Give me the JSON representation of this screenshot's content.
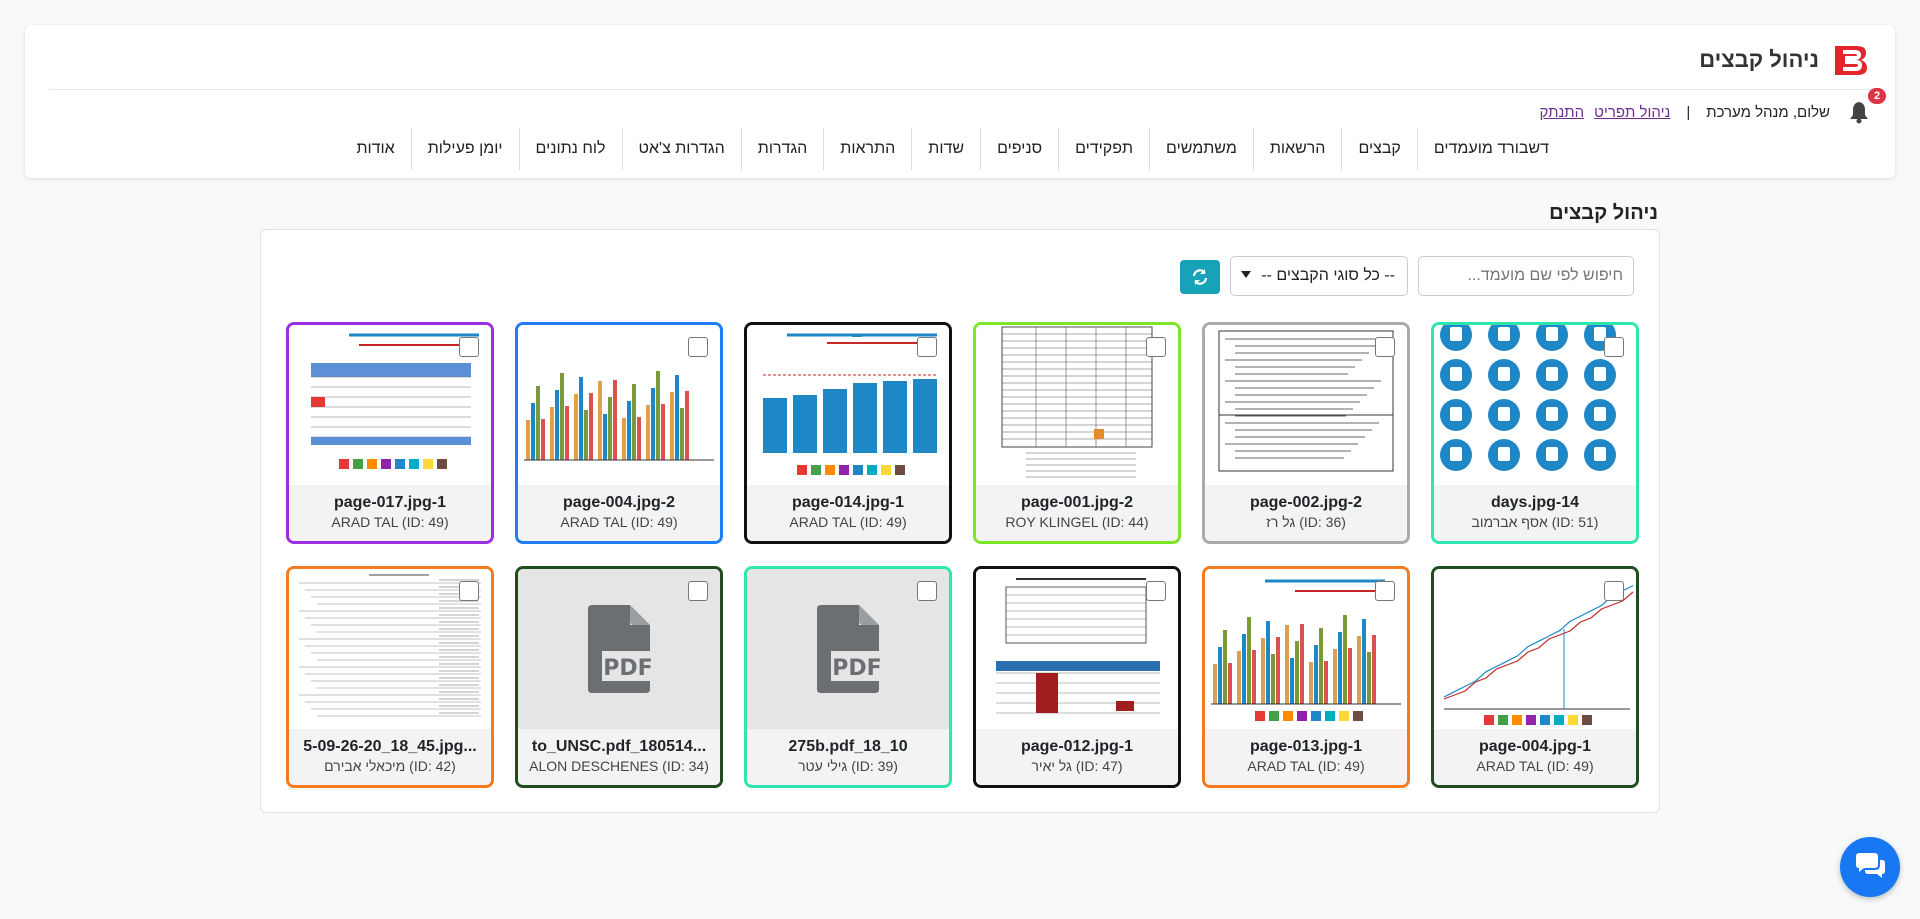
{
  "header": {
    "app_title": "ניהול קבצים",
    "notification_count": "2",
    "greeting": "שלום, מנהל מערכת",
    "separator": "|",
    "profile_link": "ניהול תפריט",
    "logout_link": "התנתק",
    "nav": [
      "דשבורד מועמדים",
      "קבצים",
      "הרשאות",
      "משתמשים",
      "תפקידים",
      "סניפים",
      "שדות",
      "התראות",
      "הגדרות",
      "הגדרות צ'אט",
      "לוח נתונים",
      "יומן פעילות",
      "אודות"
    ]
  },
  "page": {
    "title": "ניהול קבצים",
    "search_placeholder": "חיפוש לפי שם מועמד...",
    "filter_selected": "-- כל סוגי הקבצים --"
  },
  "files": [
    {
      "name": "days.jpg-14",
      "owner": "אסף אברמוב (ID: 51)",
      "border": "#2ee6b0",
      "thumb": "icons"
    },
    {
      "name": "page-002.jpg-2",
      "owner": "גל רז (ID: 36)",
      "border": "#aaaaaa",
      "thumb": "doc"
    },
    {
      "name": "page-001.jpg-2",
      "owner": "ROY KLINGEL (ID: 44)",
      "border": "#7de627",
      "thumb": "table"
    },
    {
      "name": "page-014.jpg-1",
      "owner": "ARAD TAL (ID: 49)",
      "border": "#111111",
      "thumb": "bars"
    },
    {
      "name": "page-004.jpg-2",
      "owner": "ARAD TAL (ID: 49)",
      "border": "#1f7ef5",
      "thumb": "multibars"
    },
    {
      "name": "page-017.jpg-1",
      "owner": "ARAD TAL (ID: 49)",
      "border": "#9b2fe0",
      "thumb": "redtable"
    },
    {
      "name": "page-004.jpg-1",
      "owner": "ARAD TAL (ID: 49)",
      "border": "#1f4d1f",
      "thumb": "line"
    },
    {
      "name": "page-013.jpg-1",
      "owner": "ARAD TAL (ID: 49)",
      "border": "#f57a1f",
      "thumb": "multibars2"
    },
    {
      "name": "page-012.jpg-1",
      "owner": "גל יאיר (ID: 47)",
      "border": "#111111",
      "thumb": "bluetable"
    },
    {
      "name": "275b.pdf_18_10",
      "owner": "גילי עטר (ID: 39)",
      "border": "#2ee6b0",
      "thumb": "pdf"
    },
    {
      "name": "to_UNSC.pdf_180514...",
      "owner": "ALON DESCHENES (ID: 34)",
      "border": "#1f4d1f",
      "thumb": "pdf"
    },
    {
      "name": "5-09-26-20_18_45.jpg...",
      "owner": "מיכאלי אבירם (ID: 42)",
      "border": "#f57a1f",
      "thumb": "list"
    }
  ],
  "thumb_labels": {
    "pdf_label": "PDF"
  },
  "icons": {
    "bell": "bell-icon",
    "refresh": "refresh-icon",
    "chat": "chat-icon",
    "logo": "brand-logo",
    "pdf": "pdf-file-icon",
    "caret": "caret-down-icon"
  },
  "colors": {
    "accent": "#17a2b8",
    "badge": "#dc3545",
    "link": "#6f2c91",
    "chat": "#1877f2",
    "logo": "#e2262b"
  }
}
